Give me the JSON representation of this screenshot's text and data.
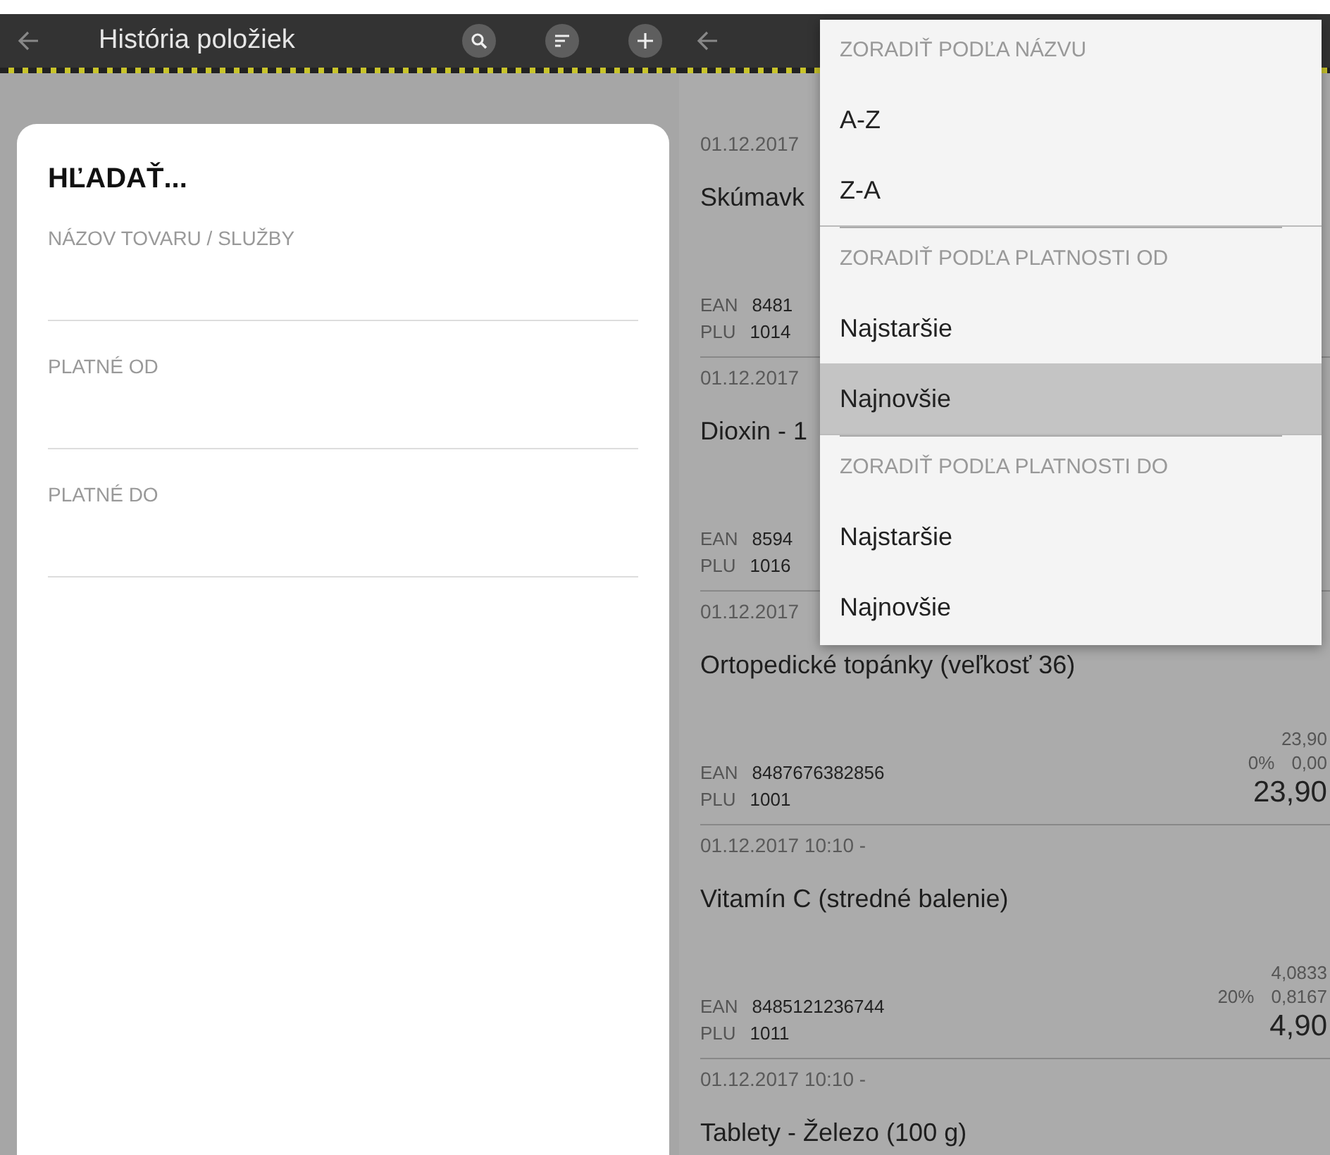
{
  "left_screen": {
    "app_bar": {
      "title": "História položiek"
    },
    "search_dialog": {
      "title": "HĽADAŤ...",
      "fields": [
        {
          "placeholder": "NÁZOV TOVARU / SLUŽBY"
        },
        {
          "placeholder": "PLATNÉ OD"
        },
        {
          "placeholder": "PLATNÉ DO"
        }
      ]
    }
  },
  "right_screen": {
    "items": [
      {
        "date": "01.12.2017",
        "name": "Skúmavk",
        "ean_label": "EAN",
        "ean": "8481",
        "plu_label": "PLU",
        "plu": "1014"
      },
      {
        "date": "01.12.2017",
        "name": "Dioxin - 1",
        "ean_label": "EAN",
        "ean": "8594",
        "plu_label": "PLU",
        "plu": "1016"
      },
      {
        "date": "01.12.2017",
        "name": "Ortopedické topánky (veľkosť 36)",
        "net": "23,90",
        "vat_rate": "0%",
        "vat": "0,00",
        "total": "23,90",
        "ean_label": "EAN",
        "ean": "8487676382856",
        "plu_label": "PLU",
        "plu": "1001"
      },
      {
        "date": "01.12.2017 10:10 -",
        "name": "Vitamín C (stredné balenie)",
        "net": "4,0833",
        "vat_rate": "20%",
        "vat": "0,8167",
        "total": "4,90",
        "ean_label": "EAN",
        "ean": "8485121236744",
        "plu_label": "PLU",
        "plu": "1011"
      },
      {
        "date": "01.12.2017 10:10 -",
        "name": "Tablety - Železo (100 g)"
      }
    ],
    "sort_menu": {
      "sections": [
        {
          "header": "ZORADIŤ PODĽA NÁZVU",
          "options": [
            {
              "label": "A-Z",
              "selected": false
            },
            {
              "label": "Z-A",
              "selected": false
            }
          ]
        },
        {
          "header": "ZORADIŤ PODĽA PLATNOSTI OD",
          "options": [
            {
              "label": "Najstaršie",
              "selected": false
            },
            {
              "label": "Najnovšie",
              "selected": true
            }
          ]
        },
        {
          "header": "ZORADIŤ PODĽA PLATNOSTI DO",
          "options": [
            {
              "label": "Najstaršie",
              "selected": false
            },
            {
              "label": "Najnovšie",
              "selected": false
            }
          ]
        }
      ]
    }
  }
}
